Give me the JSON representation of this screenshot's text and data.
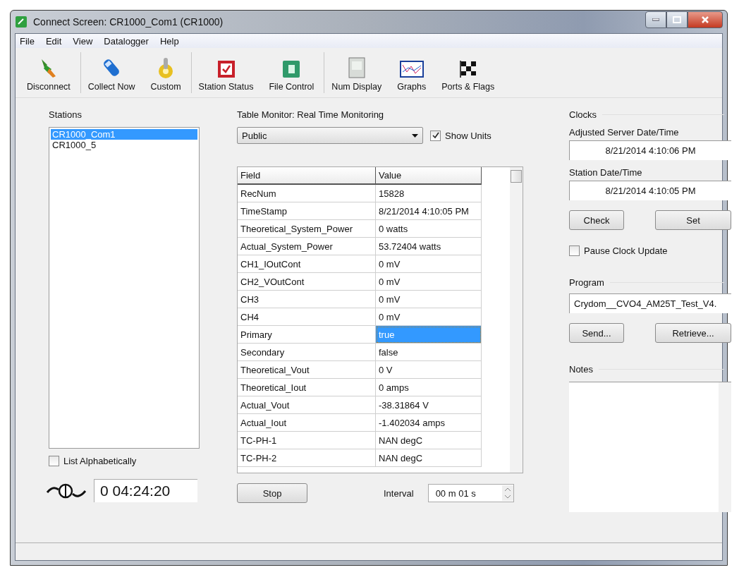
{
  "window": {
    "title": "Connect Screen: CR1000_Com1 (CR1000)"
  },
  "menu": [
    "File",
    "Edit",
    "View",
    "Datalogger",
    "Help"
  ],
  "toolbar_groups": [
    {
      "items": [
        "Disconnect"
      ]
    },
    {
      "items": [
        "Collect Now",
        "Custom"
      ]
    },
    {
      "items": [
        "Station Status",
        "File Control"
      ]
    },
    {
      "items": [
        "Num Display",
        "Graphs",
        "Ports & Flags"
      ]
    }
  ],
  "stations": {
    "title": "Stations",
    "items": [
      {
        "name": "CR1000_Com1",
        "selected": true
      },
      {
        "name": "CR1000_5",
        "selected": false
      }
    ],
    "list_alphabetically": {
      "label": "List Alphabetically",
      "checked": false
    },
    "connection_timer": "0 04:24:20"
  },
  "table_monitor": {
    "title": "Table Monitor: Real Time Monitoring",
    "table": "Public",
    "show_units": {
      "label": "Show Units",
      "checked": true
    },
    "columns": [
      "Field",
      "Value"
    ],
    "rows": [
      {
        "field": "RecNum",
        "value": "15828",
        "selected": false
      },
      {
        "field": "TimeStamp",
        "value": "8/21/2014 4:10:05 PM",
        "selected": false
      },
      {
        "field": "Theoretical_System_Power",
        "value": "0 watts",
        "selected": false
      },
      {
        "field": "Actual_System_Power",
        "value": "53.72404 watts",
        "selected": false
      },
      {
        "field": "CH1_IOutCont",
        "value": "0 mV",
        "selected": false
      },
      {
        "field": "CH2_VOutCont",
        "value": "0 mV",
        "selected": false
      },
      {
        "field": "CH3",
        "value": "0 mV",
        "selected": false
      },
      {
        "field": "CH4",
        "value": "0 mV",
        "selected": false
      },
      {
        "field": "Primary",
        "value": "true",
        "selected": true
      },
      {
        "field": "Secondary",
        "value": "false",
        "selected": false
      },
      {
        "field": "Theoretical_Vout",
        "value": "0 V",
        "selected": false
      },
      {
        "field": "Theoretical_Iout",
        "value": "0 amps",
        "selected": false
      },
      {
        "field": "Actual_Vout",
        "value": "-38.31864 V",
        "selected": false
      },
      {
        "field": "Actual_Iout",
        "value": "-1.402034 amps",
        "selected": false
      },
      {
        "field": "TC-PH-1",
        "value": "NAN degC",
        "selected": false
      },
      {
        "field": "TC-PH-2",
        "value": "NAN degC",
        "selected": false
      }
    ],
    "stop_button": "Stop",
    "interval_label": "Interval",
    "interval_value": "00 m 01 s"
  },
  "clocks": {
    "title": "Clocks",
    "adjusted_label": "Adjusted Server Date/Time",
    "adjusted_value": "8/21/2014 4:10:06 PM",
    "station_label": "Station Date/Time",
    "station_value": "8/21/2014 4:10:05 PM",
    "check_button": "Check",
    "set_button": "Set",
    "pause_clock_update": {
      "label": "Pause Clock Update",
      "checked": false
    }
  },
  "program": {
    "title": "Program",
    "name": "Crydom__CVO4_AM25T_Test_V4.",
    "send_button": "Send...",
    "retrieve_button": "Retrieve..."
  },
  "notes": {
    "title": "Notes"
  }
}
